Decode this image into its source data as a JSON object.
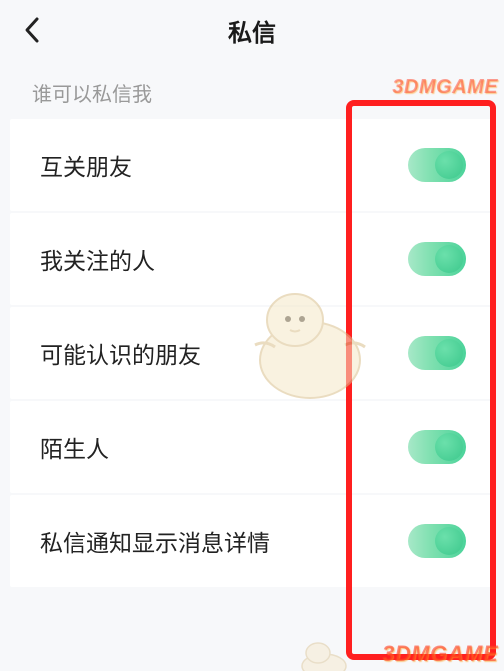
{
  "header": {
    "title": "私信"
  },
  "section": {
    "label": "谁可以私信我"
  },
  "items": [
    {
      "label": "互关朋友",
      "on": true
    },
    {
      "label": "我关注的人",
      "on": true
    },
    {
      "label": "可能认识的朋友",
      "on": true
    },
    {
      "label": "陌生人",
      "on": true
    },
    {
      "label": "私信通知显示消息详情",
      "on": true
    }
  ],
  "watermark": {
    "text": "3DMGAME"
  }
}
